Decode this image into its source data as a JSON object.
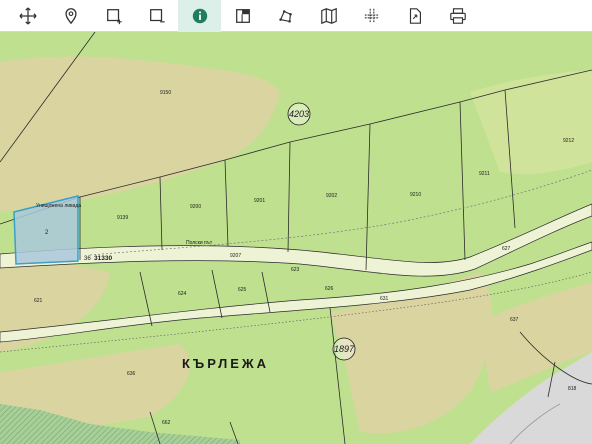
{
  "toolbar": {
    "tools": [
      {
        "name": "move-icon"
      },
      {
        "name": "location-pin-icon"
      },
      {
        "name": "add-area-icon"
      },
      {
        "name": "remove-area-icon"
      },
      {
        "name": "info-icon",
        "active": true
      },
      {
        "name": "edit-layer-icon"
      },
      {
        "name": "polygon-icon"
      },
      {
        "name": "map-icon"
      },
      {
        "name": "split-icon"
      },
      {
        "name": "export-icon"
      },
      {
        "name": "print-icon"
      }
    ],
    "active_color": "#1e7d5f"
  },
  "map": {
    "place_name": "КЪРЛЕЖА",
    "circled_numbers": [
      "4203",
      "1897"
    ],
    "selected_parcel": {
      "number": "2",
      "label_top": "Унищожена ливада",
      "fill_color": "#a9c8dc",
      "stroke_color": "#3aa0c8"
    },
    "parcel_id_label": "31330",
    "parcel_id_prefix": "36",
    "parcel_numbers": {
      "p9150": "9150",
      "p9139": "9139",
      "p9200": "9200",
      "p9201": "9201",
      "p9202": "9202",
      "p9210": "9210",
      "p9211": "9211",
      "p9212": "9212",
      "p9207": "9207",
      "p627": "627",
      "p624": "624",
      "p625": "625",
      "p626": "626",
      "p623": "623",
      "p631": "631",
      "p636": "636",
      "p637": "637",
      "p818": "818",
      "p662": "662",
      "p621": "621"
    },
    "road_label": "Полски път",
    "colors": {
      "meadow": "#bfe08f",
      "forest": "#d9d4a0",
      "road": "#f2f0df",
      "gray_area": "#d9d9d9",
      "hatched": "#8fbf8a"
    }
  }
}
